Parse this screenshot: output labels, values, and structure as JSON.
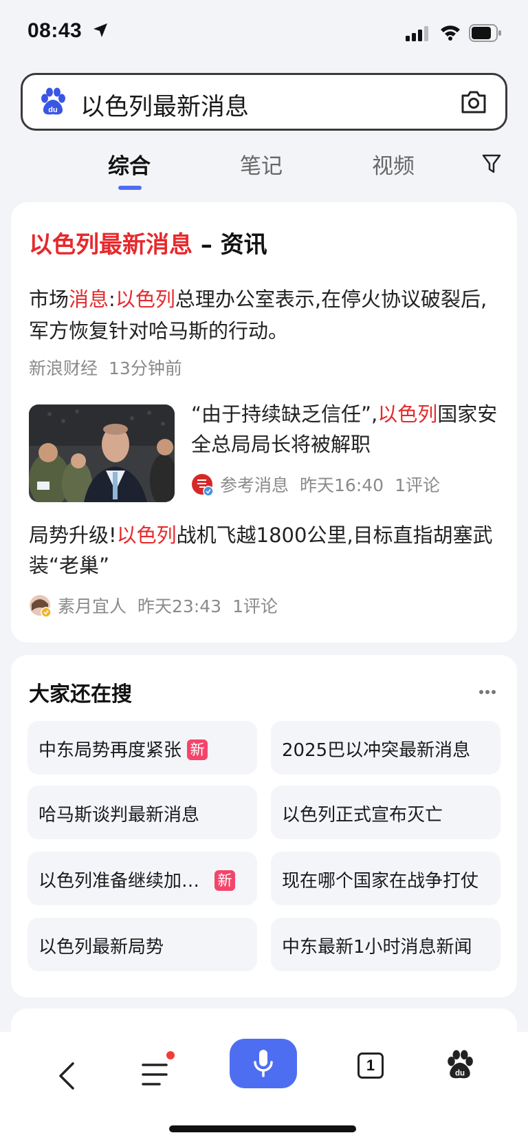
{
  "status_bar": {
    "time": "08:43"
  },
  "search": {
    "query": "以色列最新消息"
  },
  "tabs": [
    {
      "label": "综合",
      "active": true
    },
    {
      "label": "笔记",
      "active": false
    },
    {
      "label": "视频",
      "active": false
    }
  ],
  "news_card": {
    "title_highlight": "以色列最新消息",
    "title_suffix": " – 资讯",
    "lead": {
      "summary_parts": [
        "市场",
        "消息",
        ":",
        "以色列",
        "总理办公室表示,在停火协议破裂后,军方恢复针对哈马斯的行动。"
      ],
      "source": "新浪财经",
      "time": "13分钟前"
    },
    "item2": {
      "title_prefix": "“由于持续缺乏信任”,",
      "title_highlight": "以色列",
      "title_suffix": "国家安全总局局长将被解职",
      "source": "参考消息",
      "time": "昨天16:40",
      "comments": "1评论"
    },
    "item3": {
      "title_prefix": "局势升级!",
      "title_highlight": "以色列",
      "title_suffix": "战机飞越1800公里,目标直指胡塞武装“老巢”",
      "source": "素月宜人",
      "time": "昨天23:43",
      "comments": "1评论"
    }
  },
  "also_search": {
    "title": "大家还在搜",
    "new_badge": "新",
    "items": [
      {
        "label": "中东局势再度紧张",
        "new": true
      },
      {
        "label": "2025巴以冲突最新消息",
        "new": false
      },
      {
        "label": "哈马斯谈判最新消息",
        "new": false
      },
      {
        "label": "以色列正式宣布灭亡",
        "new": false
      },
      {
        "label": "以色列准备继续加…",
        "new": true
      },
      {
        "label": "现在哪个国家在战争打仗",
        "new": false
      },
      {
        "label": "以色列最新局势",
        "new": false
      },
      {
        "label": "中东最新1小时消息新闻",
        "new": false
      }
    ]
  },
  "bottom_bar": {
    "tab_count": "1"
  },
  "colors": {
    "accent": "#4e6ef2",
    "highlight": "#e5292c",
    "badge": "#f3456b"
  }
}
